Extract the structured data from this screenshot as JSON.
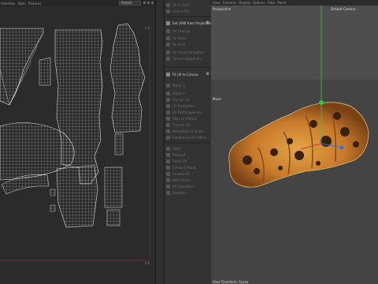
{
  "uv_editor": {
    "menu": [
      "Selection",
      "Stats",
      "Textures"
    ],
    "mode_select": "Project",
    "corner_top_right": "1,1",
    "corner_bottom_right": "1,0"
  },
  "uv_commands": [
    {
      "label": "UV to Grid",
      "active": false
    },
    {
      "label": "Grid to UV",
      "active": false
    },
    {
      "label": "Set UVW from Projection",
      "active": true
    },
    {
      "label": "UV Unwrap",
      "active": false
    },
    {
      "label": "UV Relax",
      "active": false
    },
    {
      "label": "UV Pack",
      "active": false
    },
    {
      "label": "UV Island Straighten",
      "active": false
    },
    {
      "label": "Terrace Island UVs",
      "active": false
    },
    {
      "label": "Fit UV to Canvas",
      "active": true
    },
    {
      "label": "Mirror U",
      "active": false
    },
    {
      "label": "Mirror V",
      "active": false
    },
    {
      "label": "Flip Sel UV",
      "active": false
    },
    {
      "label": "UV Straighten",
      "active": false
    },
    {
      "label": "UV Rectangularize",
      "active": false
    },
    {
      "label": "Align to Texture",
      "active": false
    },
    {
      "label": "Transfer UV",
      "active": false
    },
    {
      "label": "Normalize UV Scale",
      "active": false
    },
    {
      "label": "Randomize UV Offset",
      "active": false
    },
    {
      "label": "Stitch",
      "active": false
    },
    {
      "label": "Relaxed",
      "active": false
    },
    {
      "label": "Break UV",
      "active": false
    },
    {
      "label": "Collapse Points",
      "active": false
    },
    {
      "label": "Unweld UV",
      "active": false
    },
    {
      "label": "Weld Points",
      "active": false
    },
    {
      "label": "UV Transform",
      "active": false
    },
    {
      "label": "Rotation",
      "active": false
    },
    {
      "label": "Shift",
      "active": false
    },
    {
      "label": "Scaling",
      "active": false
    }
  ],
  "viewport": {
    "menu": [
      "View",
      "Cameras",
      "Display",
      "Options",
      "Filter",
      "Panel"
    ],
    "perspective_label": "Perspective",
    "camera_label": "Default Camera",
    "move_label": "Move",
    "bottom_label": "View Transform: Scene"
  },
  "colors": {
    "accent": "#d8d8d8",
    "uv_line": "#cfcfcf",
    "axis_y": "#2ecc40",
    "axis_x": "#e03030",
    "axis_z": "#3a6fe0"
  }
}
